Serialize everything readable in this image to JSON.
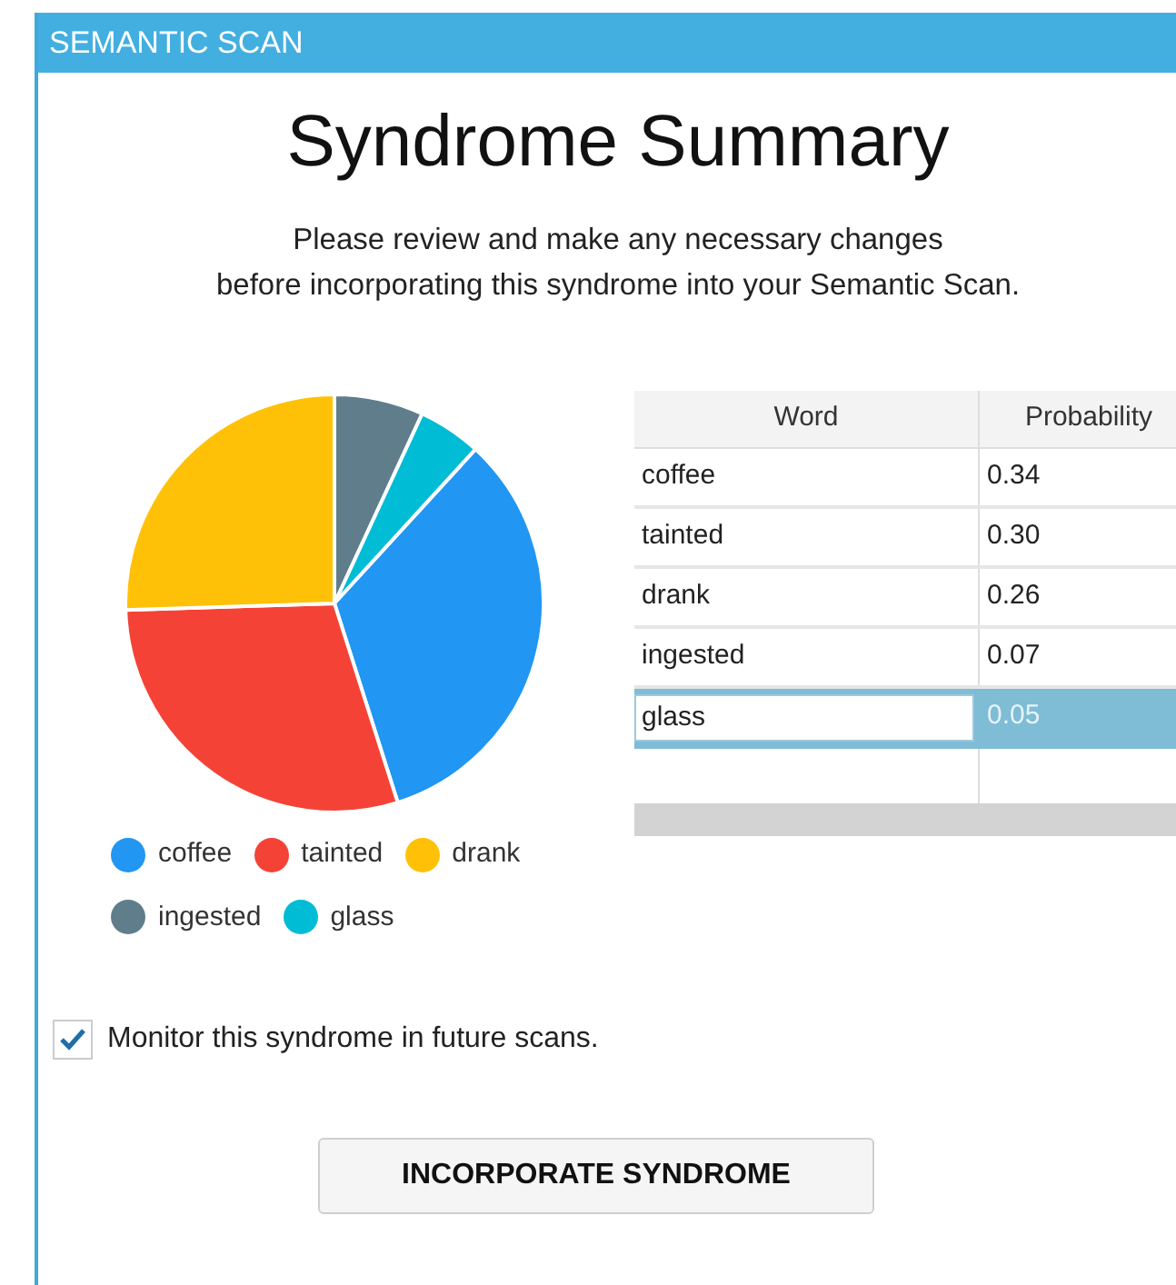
{
  "window": {
    "title": "SEMANTIC SCAN"
  },
  "heading": "Syndrome Summary",
  "instructions": [
    "Please review and make any necessary changes",
    "before incorporating this syndrome into your Semantic Scan."
  ],
  "chart_data": {
    "type": "pie",
    "categories": [
      "coffee",
      "tainted",
      "drank",
      "ingested",
      "glass"
    ],
    "values": [
      33.3,
      29.4,
      25.5,
      6.9,
      4.9
    ]
  },
  "legend": [
    {
      "color": "#2196f3"
    },
    {
      "color": "#f44336"
    },
    {
      "color": "#ffc107"
    },
    {
      "color": "#607d8b"
    },
    {
      "color": "#00bcd4"
    }
  ],
  "table": {
    "columns": [
      "Word",
      "Probability"
    ],
    "rows": [
      {
        "word": "coffee",
        "probability": "0.34",
        "selected": false
      },
      {
        "word": "tainted",
        "probability": "0.30",
        "selected": false
      },
      {
        "word": "drank",
        "probability": "0.26",
        "selected": false
      },
      {
        "word": "ingested",
        "probability": "0.07",
        "selected": false
      },
      {
        "word": "glass",
        "probability": "0.05",
        "selected": true
      }
    ]
  },
  "monitor": {
    "label": "Monitor this syndrome in future scans.",
    "checked": true
  },
  "button": "INCORPORATE SYNDROME"
}
